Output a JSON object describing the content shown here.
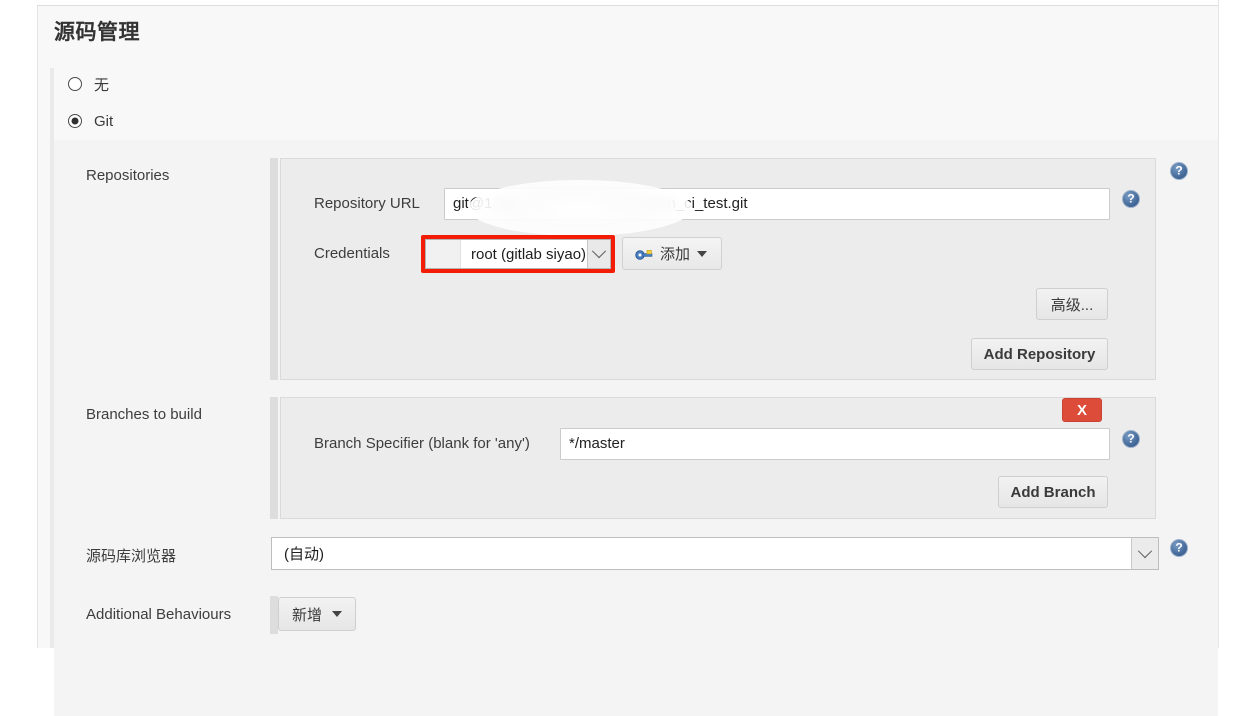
{
  "page": {
    "title": "源码管理"
  },
  "scm_options": [
    {
      "label": "无",
      "selected": false
    },
    {
      "label": "Git",
      "selected": true
    }
  ],
  "repositories": {
    "label": "Repositories",
    "repository_url": {
      "label": "Repository URL",
      "value_prefix": "git@1",
      "value_suffix": "t/python_ci_test.git",
      "redacted": true
    },
    "credentials": {
      "label": "Credentials",
      "selected": "root (gitlab siyao)",
      "highlighted": true,
      "highlight_color": "#f31d05",
      "add_button": {
        "label": "添加",
        "icon": "key-icon",
        "caret": "chevron-down-icon"
      }
    },
    "advanced_button": "高级...",
    "add_repository_button": "Add Repository",
    "help_icon": "?"
  },
  "branches": {
    "label": "Branches to build",
    "remove_button": "X",
    "branch_specifier": {
      "label": "Branch Specifier (blank for 'any')",
      "value": "*/master"
    },
    "add_branch_button": "Add Branch",
    "help_icon": "?"
  },
  "repository_browser": {
    "label": "源码库浏览器",
    "selected": "(自动)",
    "help_icon": "?"
  },
  "additional_behaviours": {
    "label": "Additional Behaviours",
    "add_button": {
      "label": "新增",
      "caret": "chevron-down-icon"
    }
  }
}
